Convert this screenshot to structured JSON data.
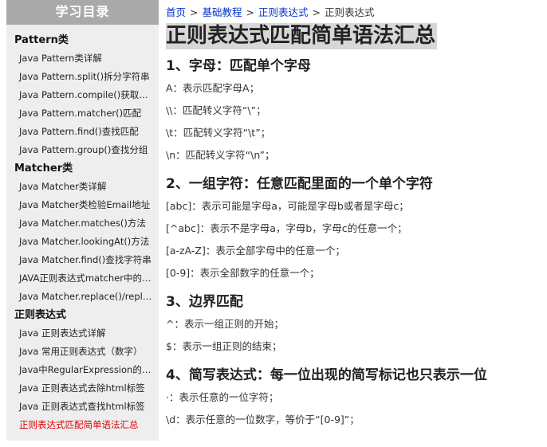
{
  "sidebar": {
    "title": "学习目录",
    "groups": [
      {
        "title": "Pattern类",
        "items": [
          "Java Pattern类详解",
          "Java Pattern.split()拆分字符串",
          "Java Pattern.compile()获取对象",
          "Java Pattern.matcher()匹配",
          "Java Pattern.find()查找匹配",
          "Java Pattern.group()查找分组"
        ]
      },
      {
        "title": "Matcher类",
        "items": [
          "Java Matcher类详解",
          "Java Matcher类检验Email地址",
          "Java Matcher.matches()方法",
          "Java Matcher.lookingAt()方法",
          "Java Matcher.find()查找字符串",
          "JAVA正则表达式matcher中的方法",
          "Java Matcher.replace()/replaceAll()"
        ]
      },
      {
        "title": "正则表达式",
        "items": [
          "Java 正则表达式详解",
          "Java 常用正则表达式（数字）",
          "Java中RegularExpression的用法",
          "Java 正则表达式去除html标签",
          "Java 正则表达式查找html标签",
          "正则表达式匹配简单语法汇总"
        ],
        "active_index": 5
      }
    ]
  },
  "breadcrumb": {
    "home": "首页",
    "basics": "基础教程",
    "regex": "正则表达式",
    "current": "正则表达式",
    "separator": ">"
  },
  "article": {
    "title": "正则表达式匹配简单语法汇总",
    "sections": [
      {
        "heading": "1、字母：匹配单个字母",
        "lines": [
          "A：表示匹配字母A；",
          "\\\\：匹配转义字符“\\”；",
          "\\t：匹配转义字符“\\t”；",
          "\\n：匹配转义字符“\\n”；"
        ]
      },
      {
        "heading": "2、一组字符：任意匹配里面的一个单个字符",
        "lines": [
          "[abc]：表示可能是字母a，可能是字母b或者是字母c；",
          "[^abc]：表示不是字母a，字母b，字母c的任意一个；",
          "[a-zA-Z]：表示全部字母中的任意一个；",
          "[0-9]：表示全部数字的任意一个；"
        ]
      },
      {
        "heading": "3、边界匹配",
        "lines": [
          "^：表示一组正则的开始；",
          "$：表示一组正则的结束；"
        ]
      },
      {
        "heading": "4、简写表达式：每一位出现的简写标记也只表示一位",
        "lines": [
          "·：表示任意的一位字符；",
          "\\d：表示任意的一位数字，等价于“[0-9]”；"
        ]
      }
    ]
  },
  "colors": {
    "link": "#0033cc",
    "active": "#dd0000",
    "sidebar_bg": "#eeeeee",
    "sidebar_header_bg": "#a9a9a9",
    "title_bg": "#d7d7d7"
  }
}
